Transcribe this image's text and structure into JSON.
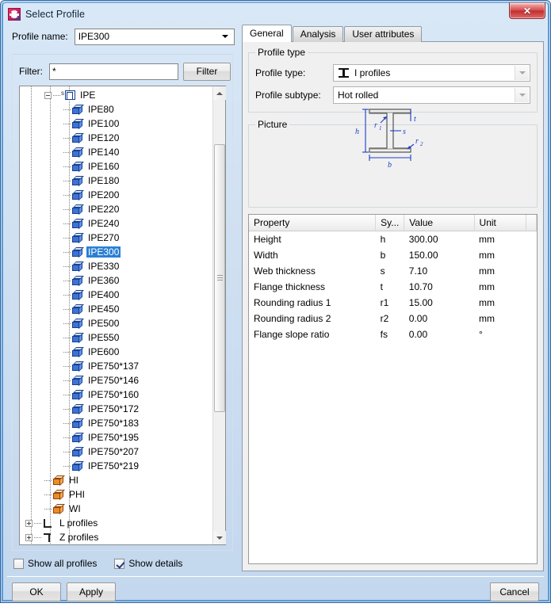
{
  "window": {
    "title": "Select Profile",
    "app_icon": "tekla-icon",
    "close_label": "✕"
  },
  "left": {
    "profile_name_label": "Profile name:",
    "profile_name_value": "IPE300",
    "filter_label": "Filter:",
    "filter_value": "*",
    "filter_placeholder": "*",
    "filter_button": "Filter",
    "tree": [
      {
        "label": "IPE",
        "level": 1,
        "icon": "group-icon",
        "expander": "minus",
        "superscript": "s"
      },
      {
        "label": "IPE80",
        "level": 2,
        "icon": "box-blue-icon"
      },
      {
        "label": "IPE100",
        "level": 2,
        "icon": "box-blue-icon"
      },
      {
        "label": "IPE120",
        "level": 2,
        "icon": "box-blue-icon"
      },
      {
        "label": "IPE140",
        "level": 2,
        "icon": "box-blue-icon"
      },
      {
        "label": "IPE160",
        "level": 2,
        "icon": "box-blue-icon"
      },
      {
        "label": "IPE180",
        "level": 2,
        "icon": "box-blue-icon"
      },
      {
        "label": "IPE200",
        "level": 2,
        "icon": "box-blue-icon"
      },
      {
        "label": "IPE220",
        "level": 2,
        "icon": "box-blue-icon"
      },
      {
        "label": "IPE240",
        "level": 2,
        "icon": "box-blue-icon"
      },
      {
        "label": "IPE270",
        "level": 2,
        "icon": "box-blue-icon"
      },
      {
        "label": "IPE300",
        "level": 2,
        "icon": "box-blue-icon",
        "selected": true
      },
      {
        "label": "IPE330",
        "level": 2,
        "icon": "box-blue-icon"
      },
      {
        "label": "IPE360",
        "level": 2,
        "icon": "box-blue-icon"
      },
      {
        "label": "IPE400",
        "level": 2,
        "icon": "box-blue-icon"
      },
      {
        "label": "IPE450",
        "level": 2,
        "icon": "box-blue-icon"
      },
      {
        "label": "IPE500",
        "level": 2,
        "icon": "box-blue-icon"
      },
      {
        "label": "IPE550",
        "level": 2,
        "icon": "box-blue-icon"
      },
      {
        "label": "IPE600",
        "level": 2,
        "icon": "box-blue-icon"
      },
      {
        "label": "IPE750*137",
        "level": 2,
        "icon": "box-blue-icon"
      },
      {
        "label": "IPE750*146",
        "level": 2,
        "icon": "box-blue-icon"
      },
      {
        "label": "IPE750*160",
        "level": 2,
        "icon": "box-blue-icon"
      },
      {
        "label": "IPE750*172",
        "level": 2,
        "icon": "box-blue-icon"
      },
      {
        "label": "IPE750*183",
        "level": 2,
        "icon": "box-blue-icon"
      },
      {
        "label": "IPE750*195",
        "level": 2,
        "icon": "box-blue-icon"
      },
      {
        "label": "IPE750*207",
        "level": 2,
        "icon": "box-blue-icon"
      },
      {
        "label": "IPE750*219",
        "level": 2,
        "icon": "box-blue-icon"
      },
      {
        "label": "HI",
        "level": 1,
        "icon": "box-orange-icon"
      },
      {
        "label": "PHI",
        "level": 1,
        "icon": "box-orange-icon"
      },
      {
        "label": "WI",
        "level": 1,
        "icon": "box-orange-icon"
      },
      {
        "label": "L profiles",
        "level": 0,
        "icon": "angle-l-icon",
        "expander": "plus"
      },
      {
        "label": "Z profiles",
        "level": 0,
        "icon": "angle-z-icon",
        "expander": "plus"
      }
    ],
    "show_all_profiles_label": "Show all profiles",
    "show_all_profiles_checked": false,
    "show_details_label": "Show details",
    "show_details_checked": true
  },
  "right": {
    "tabs": [
      {
        "label": "General",
        "active": true
      },
      {
        "label": "Analysis",
        "active": false
      },
      {
        "label": "User attributes",
        "active": false
      }
    ],
    "profile_type_group": "Profile type",
    "profile_type_label": "Profile type:",
    "profile_type_value": "I profiles",
    "profile_type_icon": "i-beam-icon",
    "profile_subtype_label": "Profile subtype:",
    "profile_subtype_value": "Hot rolled",
    "picture_group": "Picture",
    "picture": {
      "name": "i-profile-cross-section",
      "dim_labels": [
        "h",
        "b",
        "s",
        "t",
        "r1",
        "r2"
      ],
      "accent_color": "#1a3ec8"
    },
    "table": {
      "columns": [
        "Property",
        "Sy...",
        "Value",
        "Unit",
        ""
      ],
      "rows": [
        {
          "property": "Height",
          "symbol": "h",
          "value": "300.00",
          "unit": "mm"
        },
        {
          "property": "Width",
          "symbol": "b",
          "value": "150.00",
          "unit": "mm"
        },
        {
          "property": "Web thickness",
          "symbol": "s",
          "value": "7.10",
          "unit": "mm"
        },
        {
          "property": "Flange thickness",
          "symbol": "t",
          "value": "10.70",
          "unit": "mm"
        },
        {
          "property": "Rounding radius 1",
          "symbol": "r1",
          "value": "15.00",
          "unit": "mm"
        },
        {
          "property": "Rounding radius 2",
          "symbol": "r2",
          "value": "0.00",
          "unit": "mm"
        },
        {
          "property": "Flange slope ratio",
          "symbol": "fs",
          "value": "0.00",
          "unit": "°"
        }
      ]
    }
  },
  "buttons": {
    "ok": "OK",
    "apply": "Apply",
    "cancel": "Cancel"
  }
}
